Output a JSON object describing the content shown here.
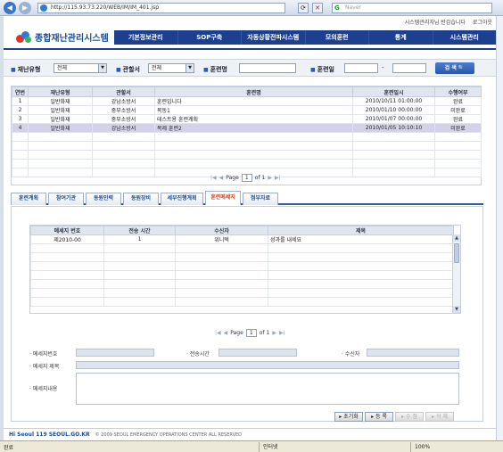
{
  "browser": {
    "url": "http://115.93.73.220/WEB/IM/IM_401.jsp",
    "search_placeholder": "Naver",
    "search_brand": "G",
    "reload_glyph": "⟳",
    "close_glyph": "✕",
    "status_left": "완료",
    "status_zone": "인터넷",
    "status_zoom": "100%"
  },
  "header": {
    "top_links": [
      "시스템관리자님 반갑습니다",
      "로그아웃"
    ],
    "app_title": "종합재난관리시스템",
    "menu": [
      "기본정보관리",
      "SOP구축",
      "자동상황전파시스템",
      "모의훈련",
      "통계",
      "시스템관리"
    ]
  },
  "filter": {
    "disaster_type_label": "재난유형",
    "disaster_type_value": "전체",
    "agency_label": "관할서",
    "agency_value": "전체",
    "drill_name_label": "훈련명",
    "drill_date_label": "훈련일",
    "date_sep": "-",
    "search_button": "검 색 🔍"
  },
  "drill_table": {
    "headers": [
      "연번",
      "재난유형",
      "관할서",
      "훈련명",
      "훈련일시",
      "수행여부"
    ],
    "rows": [
      [
        "1",
        "일반화재",
        "강남소방서",
        "훈련입니다",
        "2010/10/11 01:00:00",
        "완료"
      ],
      [
        "2",
        "일반화재",
        "중부소방서",
        "목동1",
        "2010/01/10 00:00:00",
        "미완료"
      ],
      [
        "3",
        "일반화재",
        "중부소방서",
        "테스트용 훈련계획",
        "2010/01/07 00:00:00",
        "완료"
      ],
      [
        "4",
        "일반화재",
        "강남소방서",
        "복제 훈련2",
        "2010/01/05 10:10:10",
        "미완료"
      ]
    ],
    "selected_row": 4
  },
  "pager_top": {
    "label": "Page",
    "page": "1",
    "of": "of 1"
  },
  "tabs": [
    "훈련계획",
    "참여기관",
    "동원인력",
    "동원장비",
    "세부진행계획",
    "훈련메세지",
    "첨부자료"
  ],
  "active_tab": 5,
  "message_table": {
    "headers": [
      "메세지 번호",
      "전송 시간",
      "수신자",
      "제목"
    ],
    "rows": [
      [
        "제2010-00",
        "1",
        "위니텍",
        "성과를 내세요"
      ]
    ]
  },
  "pager_bottom": {
    "label": "Page",
    "page": "1",
    "of": "of 1"
  },
  "form": {
    "msg_no_label": "메세지번호",
    "send_time_label": "전송시간",
    "receiver_label": "수신자",
    "subject_label": "메세지 제목",
    "content_label": "메세지내용"
  },
  "actions": [
    "초기화",
    "등 록",
    "수 정",
    "삭 제"
  ],
  "footer": {
    "logo": "Hi Seoul 119 SEOUL.GO.KR",
    "copyright": "© 2009 SEOUL EMERGENCY OPERATIONS CENTER ALL RESERVED"
  }
}
